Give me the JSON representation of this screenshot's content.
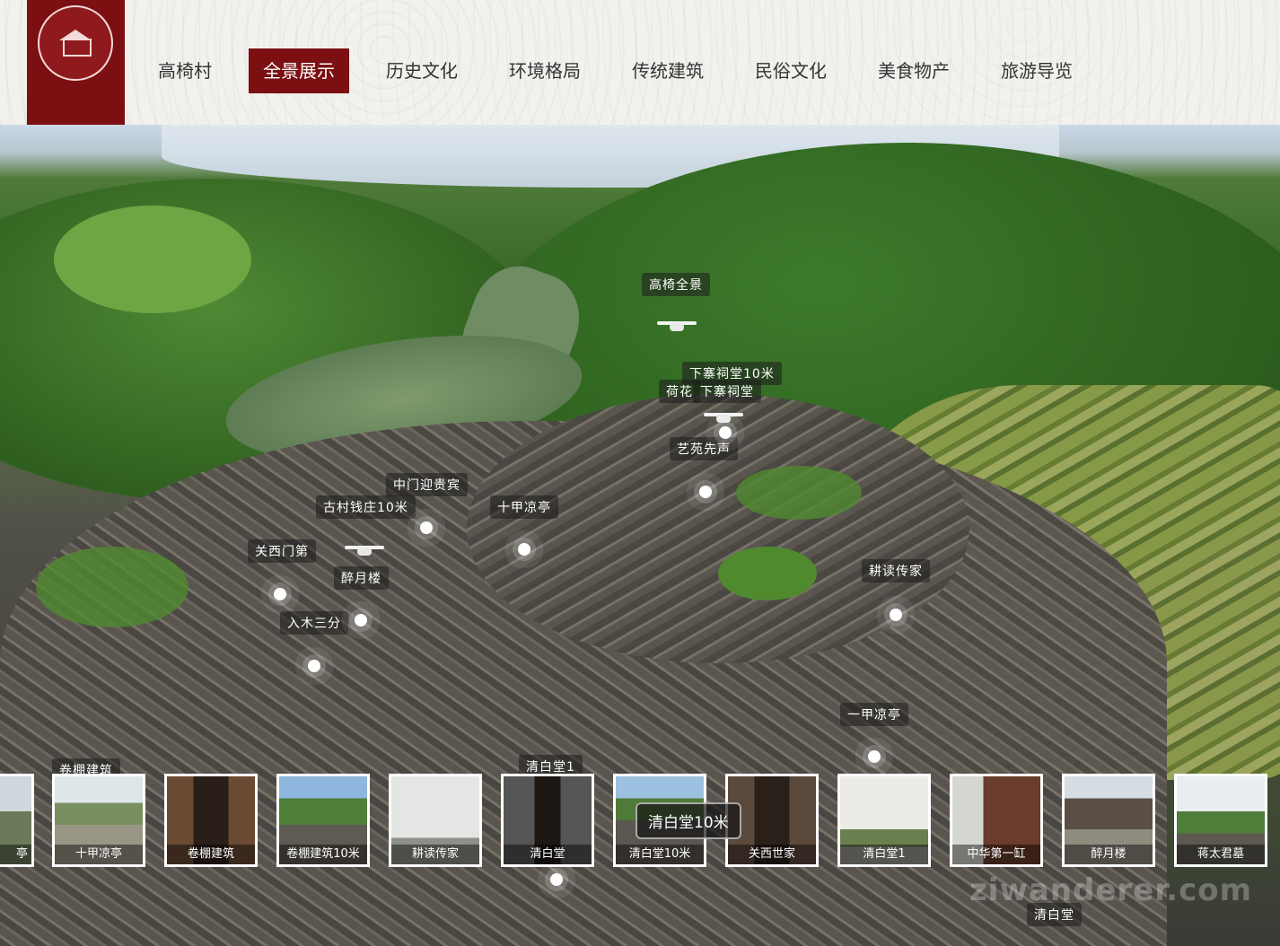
{
  "header": {
    "logo_icon": "village-seal-icon",
    "nav": [
      {
        "label": "高椅村",
        "active": false
      },
      {
        "label": "全景展示",
        "active": true
      },
      {
        "label": "历史文化",
        "active": false
      },
      {
        "label": "环境格局",
        "active": false
      },
      {
        "label": "传统建筑",
        "active": false
      },
      {
        "label": "民俗文化",
        "active": false
      },
      {
        "label": "美食物产",
        "active": false
      },
      {
        "label": "旅游导览",
        "active": false
      }
    ],
    "accent_color": "#7b0f12"
  },
  "hotspots": [
    {
      "label": "高椅全景"
    },
    {
      "label": "下寨祠堂10米"
    },
    {
      "label": "荷花"
    },
    {
      "label": "下寨祠堂"
    },
    {
      "label": "艺苑先声"
    },
    {
      "label": "中门迎贵宾"
    },
    {
      "label": "古村钱庄10米"
    },
    {
      "label": "十甲凉亭"
    },
    {
      "label": "关西门第"
    },
    {
      "label": "醉月楼"
    },
    {
      "label": "入木三分"
    },
    {
      "label": "耕读传家"
    },
    {
      "label": "一甲凉亭"
    },
    {
      "label": "卷棚建筑"
    },
    {
      "label": "清白堂1"
    },
    {
      "label": "清白堂"
    }
  ],
  "thumbnails": [
    {
      "caption": "亭"
    },
    {
      "caption": "十甲凉亭"
    },
    {
      "caption": "卷棚建筑"
    },
    {
      "caption": "卷棚建筑10米"
    },
    {
      "caption": "耕读传家"
    },
    {
      "caption": "清白堂"
    },
    {
      "caption": "清白堂10米"
    },
    {
      "caption": "关西世家"
    },
    {
      "caption": "清白堂1"
    },
    {
      "caption": "中华第一缸"
    },
    {
      "caption": "醉月楼"
    },
    {
      "caption": "蒋太君墓"
    }
  ],
  "tooltip": "清白堂10米",
  "watermark": "ziwanderer.com"
}
